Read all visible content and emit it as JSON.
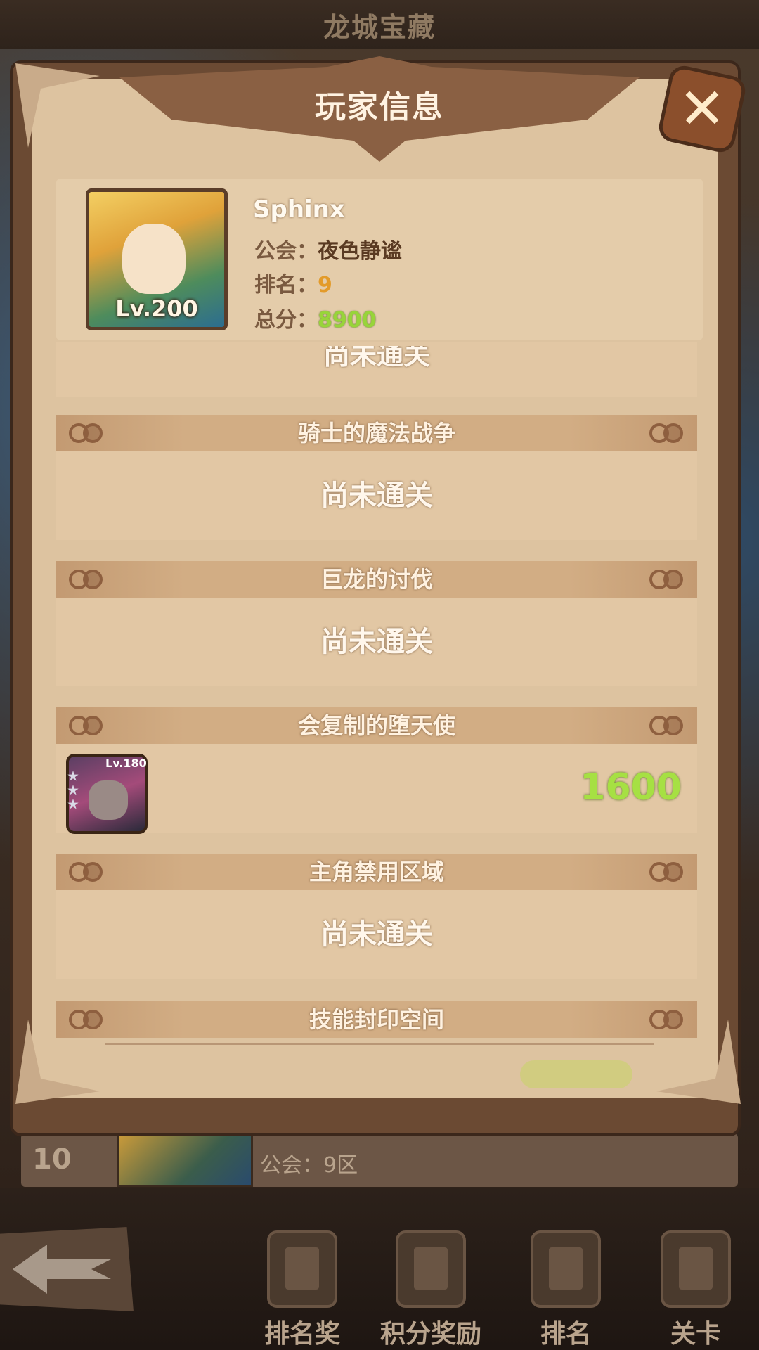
{
  "background": {
    "title": "龙城宝藏",
    "row": {
      "rank": "10",
      "guild_label": "公会：9区"
    }
  },
  "modal": {
    "title": "玩家信息",
    "close_icon": "close-icon"
  },
  "player": {
    "name": "Sphinx",
    "level": "Lv.200",
    "guild_key": "公会：",
    "guild_value": "夜色静谧",
    "rank_key": "排名：",
    "rank_value": "9",
    "score_key": "总分：",
    "score_value": "8900"
  },
  "stages": [
    {
      "title": "",
      "status": "尚未通关"
    },
    {
      "title": "骑士的魔法战争",
      "status": "尚未通关"
    },
    {
      "title": "巨龙的讨伐",
      "status": "尚未通关"
    },
    {
      "title": "会复制的堕天使",
      "status": "",
      "hero_level": "Lv.180",
      "score": "1600"
    },
    {
      "title": "主角禁用区域",
      "status": "尚未通关"
    },
    {
      "title": "技能封印空间",
      "status": ""
    }
  ],
  "nav": {
    "back_icon": "back-arrow-icon",
    "items": [
      {
        "label": "排名奖"
      },
      {
        "label": "积分奖励"
      },
      {
        "label": "排名"
      },
      {
        "label": "关卡"
      }
    ]
  },
  "colors": {
    "parchment": "#ddc3a0",
    "frame": "#6b4a33",
    "score_green": "#98d43a",
    "rank_orange": "#e39b2a"
  }
}
